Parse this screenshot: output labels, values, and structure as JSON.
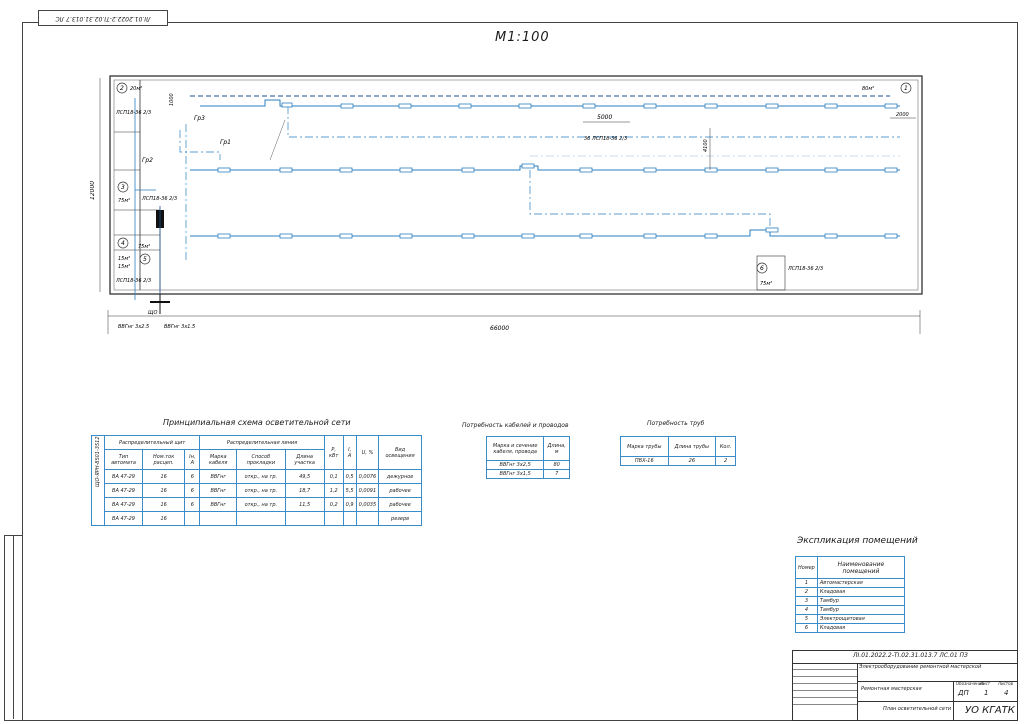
{
  "stamp_top_left": "ЛІ.01.2022.2-ТІ.02.31.013.7 ЛС",
  "drawing_title": "М1:100",
  "plan": {
    "dim_total_width": "66000",
    "dim_total_height": "12000",
    "dim_span_5000": "5000",
    "dim_right_2000": "2000",
    "dim_vertical_1000": "1000",
    "dim_vertical_4100": "4100",
    "room_labels": [
      "1",
      "2",
      "3",
      "4",
      "5",
      "6"
    ],
    "area_labels": [
      "80м²",
      "20м²",
      "75м²",
      "75м²",
      "15м²",
      "15м²",
      "75м²"
    ],
    "group_labels": [
      "Гр1",
      "Гр2",
      "Гр3"
    ],
    "fixture_labels": [
      "ЛСП18-36 2/3",
      "ЛСП18-36 2/3",
      "ЛСП18-36 2/3",
      "ЛСП18-36 2/3",
      "36 ЛСП18-36 2/3"
    ],
    "cable_labels": [
      "ВВГнг 3х2.5",
      "ЩО",
      "ВВГнг 3х1.5"
    ]
  },
  "schema_table": {
    "title": "Принципиальная схема осветительной сети",
    "header_group1": "Распределительный щит",
    "header_group2": "Распределительная линия",
    "headers": [
      "№ гр",
      "Тип автомата",
      "Ном.ток расцеп.",
      "Iн, А",
      "Марка кабеля",
      "Способ прокладки",
      "Длина участка",
      "Р, кВт",
      "I, А",
      "U, %",
      "Вид освещения"
    ],
    "side_label": "ЩО-ЯРН-8501-3512",
    "rows": [
      [
        "1",
        "ВА 47-29",
        "16",
        "6",
        "ВВГнг",
        "откр., на тр.",
        "49,5",
        "0,1",
        "0,5",
        "0,0076",
        "дежурное"
      ],
      [
        "2",
        "ВА 47-29",
        "16",
        "6",
        "ВВГнг",
        "откр., на тр.",
        "18,7",
        "1,2",
        "5,5",
        "0,0091",
        "рабочее"
      ],
      [
        "3",
        "ВА 47-29",
        "16",
        "6",
        "ВВГнг",
        "откр., на тр.",
        "11,5",
        "0,2",
        "0,9",
        "0,0035",
        "рабочее"
      ],
      [
        "4",
        "ВА 47-29",
        "16",
        "",
        "",
        "",
        "",
        "",
        "",
        "",
        "резерв"
      ]
    ]
  },
  "cables_table": {
    "title": "Потребность кабелей и проводов",
    "headers": [
      "Марка и сечение кабеля, провода",
      "Длина, м"
    ],
    "rows": [
      [
        "ВВГнг 3х2,5",
        "80"
      ],
      [
        "ВВГнг 3х1,5",
        "7"
      ]
    ]
  },
  "pipes_table": {
    "title": "Потребность труб",
    "headers": [
      "Марка трубы",
      "Длина трубы",
      "Кол."
    ],
    "rows": [
      [
        "ПВХ-16",
        "26",
        "2"
      ]
    ]
  },
  "rooms_table": {
    "title": "Экспликация помещений",
    "headers": [
      "Номер",
      "Наименование помещений"
    ],
    "rows": [
      [
        "1",
        "Автомастерская"
      ],
      [
        "2",
        "Кладовая"
      ],
      [
        "3",
        "Тамбур"
      ],
      [
        "4",
        "Тамбур"
      ],
      [
        "5",
        "Электрощитовая"
      ],
      [
        "6",
        "Кладовая"
      ]
    ]
  },
  "title_block": {
    "doc_code": "ЛІ.01.2022.2-ТІ.02.31.013.7 ЛС.01 ПЗ",
    "description": "Электрооборудование ремонтной мастерской",
    "sheet_type": "Обозначение",
    "sheet_label": "Лист",
    "sheets_label": "Листов",
    "stage": "ДП",
    "sheet": "1",
    "sheets": "4",
    "org": "УО КГАТК",
    "drawing_name": "План осветительной сети",
    "subtitle": "Ремонтная мастерская"
  }
}
